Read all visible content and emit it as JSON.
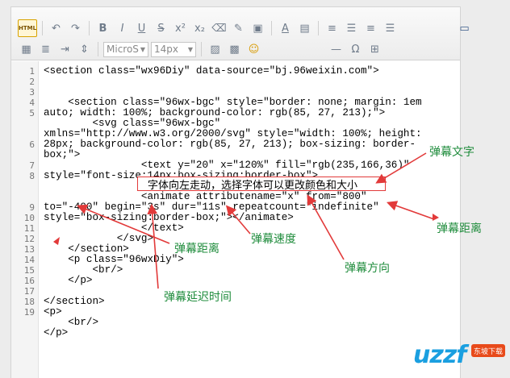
{
  "toolbar": {
    "html_label": "HTML",
    "font_family_value": "MicroS",
    "font_size_value": "14px",
    "row1_icons": [
      "undo-icon",
      "redo-icon",
      "bold-icon",
      "italic-icon",
      "underline-icon",
      "strikethrough-icon",
      "superscript-icon",
      "subscript-icon",
      "eraser-icon",
      "format-painter-icon",
      "paste-icon",
      "text-color-icon",
      "highlight-icon",
      "align-left-icon",
      "align-center-icon",
      "align-right-icon",
      "align-justify-icon",
      "fullscreen-icon"
    ],
    "row2_icons": [
      "border-icon",
      "line-height-icon",
      "indent-icon",
      "spacing-icon",
      "insert-image-icon",
      "emoji-icon",
      "horizontal-rule-icon",
      "omega-icon",
      "link-icon"
    ]
  },
  "code": {
    "line_numbers": [
      "1",
      "2",
      "3",
      "4",
      "5",
      "",
      "",
      "6",
      "",
      "7",
      "8",
      "",
      "",
      "9",
      "10",
      "11",
      "12",
      "13",
      "14",
      "15",
      "16",
      "17",
      "18",
      "19"
    ],
    "lines": [
      "<section class=\"wx96Diy\" data-source=\"bj.96weixin.com\">",
      "",
      "",
      "    <section class=\"96wx-bgc\" style=\"border: none; margin: 1em",
      "auto; width: 100%; background-color: rgb(85, 27, 213);\">",
      "        <svg class=\"96wx-bgc\"",
      "xmlns=\"http://www.w3.org/2000/svg\" style=\"width: 100%; height:",
      "28px; background-color: rgb(85, 27, 213); box-sizing: border-",
      "box;\">",
      "                <text y=\"20\" x=\"120%\" fill=\"rgb(235,166,36)\"",
      "style=\"font-size:14px;box-sizing:border-box\">",
      "",
      "                <animate attributename=\"x\" from=\"800\"",
      "to=\"-400\" begin=\"3s\" dur=\"11s\" repeatcount=\"indefinite\"",
      "style=\"box-sizing:border-box;\"></animate>",
      "                </text>",
      "            </svg>",
      "    </section>",
      "    <p class=\"96wxDiy\">",
      "        <br/>",
      "    </p>",
      "",
      "</section>",
      "<p>",
      "    <br/>",
      "</p>"
    ]
  },
  "tooltip_text": "字体向左走动，选择字体可以更改颜色和大小",
  "annotations": {
    "danmu_text": "弹幕文字",
    "danmu_distance_right": "弹幕距离",
    "danmu_distance": "弹幕距离",
    "danmu_speed": "弹幕速度",
    "danmu_direction": "弹幕方向",
    "danmu_delay": "弹幕延迟时间"
  },
  "colors": {
    "annotation": "#1f8c3c",
    "arrow": "#e23a3a",
    "tooltip_border": "#e23a3a"
  },
  "watermark": {
    "brand": "uzzf",
    "badge": "东坡下载"
  }
}
